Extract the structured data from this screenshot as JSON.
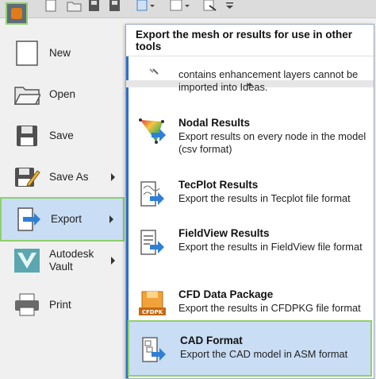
{
  "toolbar": {
    "icons": [
      "app-menu-icon",
      "new-file-icon",
      "open-folder-icon",
      "save-icon",
      "save-as-icon",
      "view-icon",
      "layout-icon",
      "settings-icon",
      "customize-icon"
    ]
  },
  "menu": {
    "items": [
      {
        "label": "New",
        "icon": "new-file-icon",
        "has_submenu": false
      },
      {
        "label": "Open",
        "icon": "open-folder-icon",
        "has_submenu": false
      },
      {
        "label": "Save",
        "icon": "save-icon",
        "has_submenu": false
      },
      {
        "label": "Save As",
        "icon": "save-as-icon",
        "has_submenu": true
      },
      {
        "label": "Export",
        "icon": "export-icon",
        "has_submenu": true,
        "selected": true
      },
      {
        "label": "Autodesk\nVault",
        "icon": "vault-icon",
        "has_submenu": true
      },
      {
        "label": "Print",
        "icon": "printer-icon",
        "has_submenu": false
      }
    ]
  },
  "panel": {
    "header": "Export the mesh or results for use in other tools",
    "items": [
      {
        "title": "",
        "description": "contains enhancement layers cannot be imported into Ideas."
      },
      {
        "title": "Nodal Results",
        "description": "Export results on every node in the model (csv format)",
        "icon": "nodal-results-icon"
      },
      {
        "title": "TecPlot Results",
        "description": "Export the results in Tecplot file format",
        "icon": "tecplot-icon"
      },
      {
        "title": "FieldView Results",
        "description": "Export the results in FieldView file format",
        "icon": "fieldview-icon"
      },
      {
        "title": "CFD Data Package",
        "description": "Export the results in CFDPKG file format",
        "icon": "cfdpkg-icon",
        "badge": "CFDPK"
      },
      {
        "title": "CAD Format",
        "description": "Export the CAD model in ASM format",
        "icon": "cad-format-icon",
        "selected": true
      }
    ]
  },
  "colors": {
    "selection_bg": "#c9ddf5",
    "selection_border": "#8ed16a",
    "accent_blue": "#2c6fd0",
    "export_arrow": "#2f7fd6"
  }
}
